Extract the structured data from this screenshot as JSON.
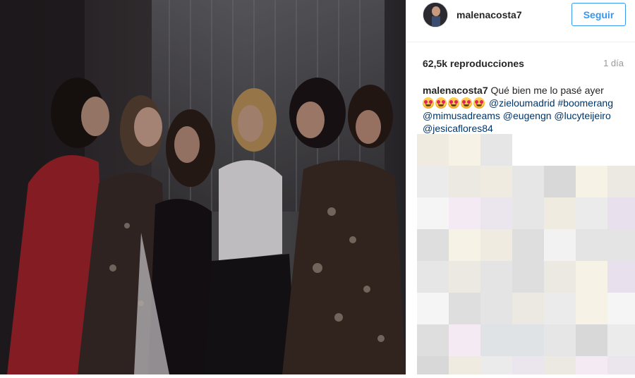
{
  "post": {
    "username": "malenacosta7",
    "follow_label": "Seguir",
    "views": "62,5k reproducciones",
    "time": "1 día",
    "caption": {
      "text": "Qué bien me lo pasé ayer",
      "emoji_count": 5,
      "emoji_icon": "smiling-face-with-heart-eyes-icon",
      "mentions": [
        "@zieloumadrid",
        "#boomerang",
        "@mimusadreams",
        "@eugengn",
        "@lucyteijeiro",
        "@jesicaflores84"
      ]
    }
  },
  "colors": {
    "accent": "#3897f0",
    "link": "#003569",
    "text": "#262626",
    "muted": "#999999"
  }
}
